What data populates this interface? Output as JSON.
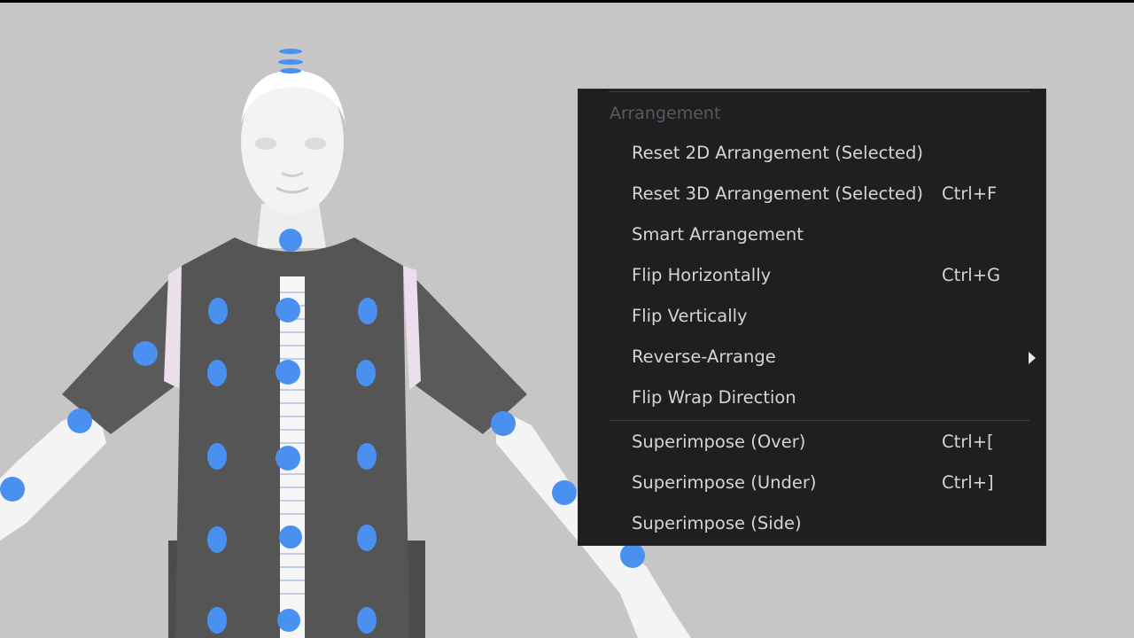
{
  "viewport": {
    "background": "#c6c6c6",
    "pin_color": "#4a90f0",
    "garment_color": "#585858"
  },
  "context_menu": {
    "header": "Arrangement",
    "items": [
      {
        "label": "Reset 2D Arrangement (Selected)",
        "shortcut": ""
      },
      {
        "label": "Reset 3D Arrangement (Selected)",
        "shortcut": "Ctrl+F"
      },
      {
        "label": "Smart Arrangement",
        "shortcut": ""
      },
      {
        "label": "Flip Horizontally",
        "shortcut": "Ctrl+G"
      },
      {
        "label": "Flip Vertically",
        "shortcut": ""
      },
      {
        "label": "Reverse-Arrange",
        "shortcut": "",
        "submenu": true
      },
      {
        "label": "Flip Wrap Direction",
        "shortcut": ""
      },
      {
        "label": "Superimpose (Over)",
        "shortcut": "Ctrl+["
      },
      {
        "label": "Superimpose (Under)",
        "shortcut": "Ctrl+]"
      },
      {
        "label": "Superimpose (Side)",
        "shortcut": ""
      }
    ]
  }
}
